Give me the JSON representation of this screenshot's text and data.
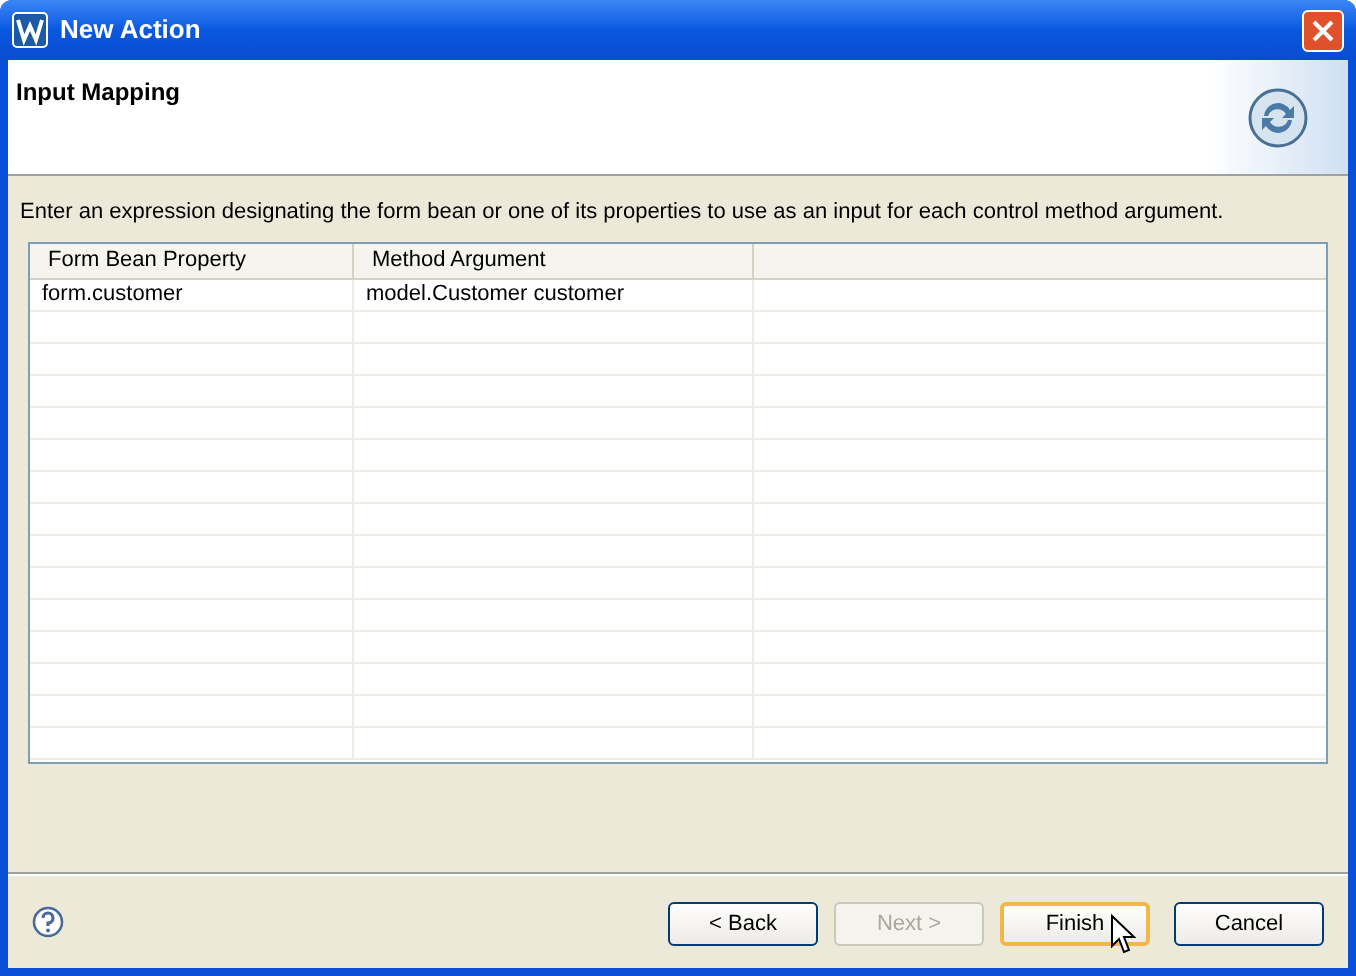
{
  "window": {
    "title": "New Action"
  },
  "header": {
    "title": "Input Mapping"
  },
  "description": "Enter an expression designating the form bean or one of its properties to use as an input for each control method argument.",
  "table": {
    "columns": [
      "Form Bean Property",
      "Method Argument"
    ],
    "rows": [
      [
        "form.customer",
        "model.Customer customer"
      ]
    ]
  },
  "buttons": [
    {
      "label": "< Back",
      "disabled": false,
      "default": false
    },
    {
      "label": "Next >",
      "disabled": true,
      "default": false
    },
    {
      "label": "Finish",
      "disabled": false,
      "default": true
    },
    {
      "label": "Cancel",
      "disabled": false,
      "default": false
    }
  ]
}
